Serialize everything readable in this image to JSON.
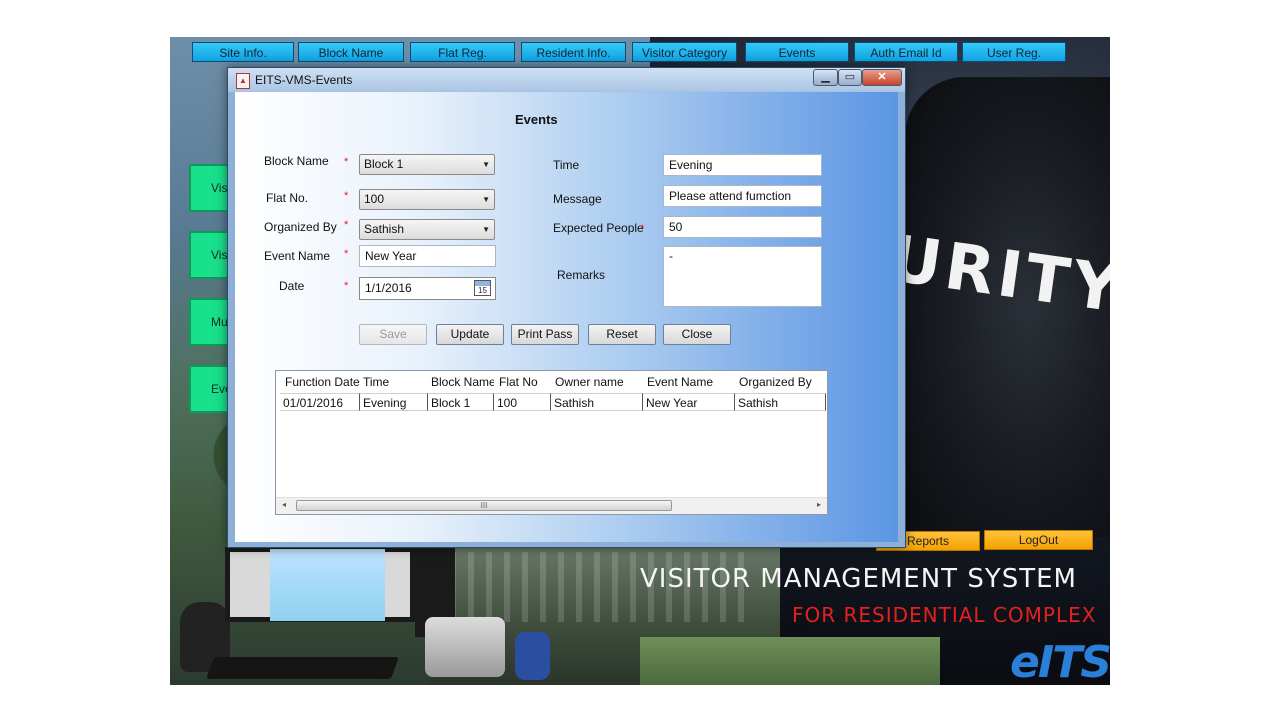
{
  "topnav": {
    "site_info": "Site Info.",
    "block_name": "Block Name",
    "flat_reg": "Flat Reg.",
    "resident_info": "Resident Info.",
    "visitor_category": "Visitor Category",
    "events": "Events",
    "auth_email": "Auth Email Id",
    "user_reg": "User Reg."
  },
  "side_buttons": [
    "Visi",
    "Visi",
    "Multi",
    "Even"
  ],
  "bottom_buttons": {
    "reports": "Reports",
    "logout": "LogOut"
  },
  "background": {
    "security_text": "URITY",
    "title": "VISITOR MANAGEMENT SYSTEM",
    "subtitle": "FOR RESIDENTIAL COMPLEX",
    "logo": "eITS"
  },
  "window": {
    "title": "EITS-VMS-Events",
    "min_icon": "minimize-icon",
    "max_icon": "maximize-icon",
    "close_icon": "close-icon"
  },
  "form": {
    "heading": "Events",
    "block_name_label": "Block Name",
    "block_name_value": "Block 1",
    "flat_no_label": "Flat No.",
    "flat_no_value": "100",
    "organized_by_label": "Organized By",
    "organized_by_value": "Sathish",
    "event_name_label": "Event Name",
    "event_name_value": "New Year",
    "date_label": "Date",
    "date_value": "1/1/2016",
    "time_label": "Time",
    "time_value": "Evening",
    "message_label": "Message",
    "message_value": "Please attend fumction",
    "expected_people_label": "Expected People",
    "expected_people_value": "50",
    "remarks_label": "Remarks",
    "remarks_value": "-",
    "required_mark": "*",
    "calendar_icon": "calendar-icon",
    "calendar_day": "15"
  },
  "buttons": {
    "save": "Save",
    "update": "Update",
    "print_pass": "Print Pass",
    "reset": "Reset",
    "close": "Close"
  },
  "grid": {
    "columns": [
      "Function Date",
      "Time",
      "Block Name",
      "Flat No",
      "Owner name",
      "Event Name",
      "Organized By"
    ],
    "rows": [
      [
        "01/01/2016",
        "Evening",
        "Block 1",
        "100",
        "Sathish",
        "New Year",
        "Sathish"
      ]
    ],
    "scroll_left": "◂",
    "scroll_right": "▸",
    "scroll_grip": "III"
  },
  "colors": {
    "nav_button": "#10a4e4",
    "side_button": "#19e08a",
    "orange_button": "#f4a100",
    "subtitle_red": "#e42020",
    "required_red": "#e02020"
  }
}
